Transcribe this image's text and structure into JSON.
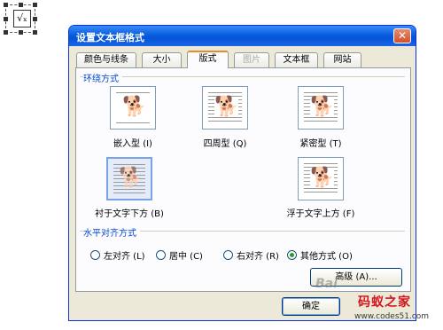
{
  "desktop_icon": {
    "glyph": "√ₓ"
  },
  "dialog": {
    "title": "设置文本框格式",
    "close_glyph": "✕",
    "tabs": [
      {
        "label": "颜色与线条"
      },
      {
        "label": "大小"
      },
      {
        "label": "版式"
      },
      {
        "label": "图片"
      },
      {
        "label": "文本框"
      },
      {
        "label": "网站"
      }
    ],
    "wrap_group_label": "环绕方式",
    "wrap_styles": [
      {
        "label": "嵌入型 (I)"
      },
      {
        "label": "四周型 (Q)"
      },
      {
        "label": "紧密型 (T)"
      },
      {
        "label": "衬于文字下方 (B)"
      },
      {
        "label": "浮于文字上方 (F)"
      }
    ],
    "align_group_label": "水平对齐方式",
    "align_options": [
      {
        "label": "左对齐 (L)"
      },
      {
        "label": "居中 (C)"
      },
      {
        "label": "右对齐 (R)"
      },
      {
        "label": "其他方式 (O)"
      }
    ],
    "advanced_button": "高级 (A)...",
    "ok_button": "确定"
  },
  "watermark": {
    "logo": "码蚁之家",
    "url": "www.codes51.com",
    "baidu": "Bai"
  }
}
